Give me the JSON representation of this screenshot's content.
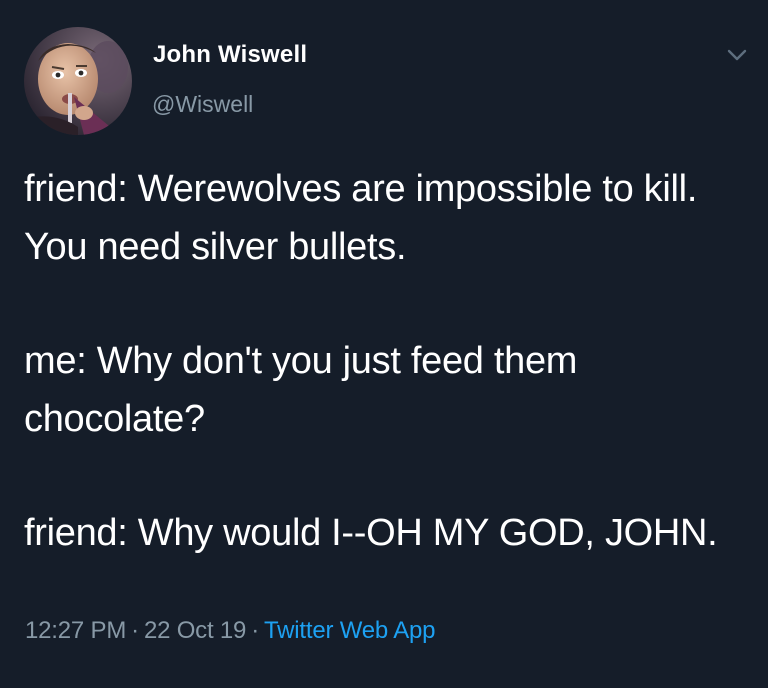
{
  "author": {
    "display_name": "John Wiswell",
    "handle": "@Wiswell"
  },
  "tweet": {
    "paragraphs": [
      "friend: Werewolves are impossible to kill. You need silver bullets.",
      "me: Why don't you just feed them chocolate?",
      "friend: Why would I--OH MY GOD, JOHN."
    ]
  },
  "meta": {
    "time": "12:27 PM",
    "separator": "·",
    "date": "22 Oct 19",
    "source": "Twitter Web App"
  },
  "icons": {
    "caret": "chevron-down-icon"
  },
  "colors": {
    "background": "#151d29",
    "text": "#ffffff",
    "secondary_text": "#8899a6",
    "link": "#1da1f2"
  }
}
